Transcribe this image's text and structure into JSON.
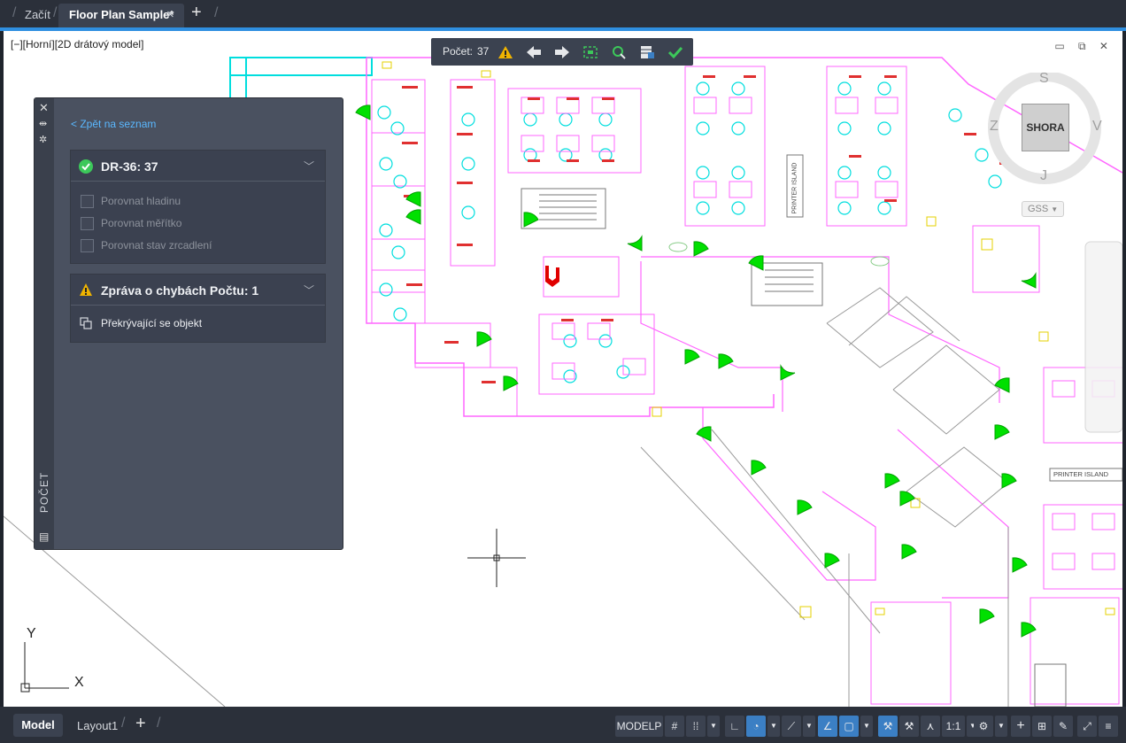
{
  "tabs": {
    "start": "Začít",
    "document": "Floor Plan Sample*",
    "close_glyph": "×",
    "new_glyph": "+"
  },
  "viewport": {
    "view_label": "[−][Horní][2D drátový model]",
    "window_controls": "▭ ⧉ ✕"
  },
  "viewcube": {
    "top": "SHORA",
    "north": "S",
    "south": "J",
    "east": "V",
    "west": "Z",
    "ucs": "GSS"
  },
  "plan_labels": {
    "printer_island_vertical": "PRINTER ISLAND",
    "printer_island_horizontal": "PRINTER ISLAND"
  },
  "ucs_icon": {
    "x": "X",
    "y": "Y"
  },
  "count_toolbar": {
    "label": "Počet:",
    "value": "37",
    "icons": [
      "warning-icon",
      "arrow-left-icon",
      "arrow-right-icon",
      "zoom-extents-icon",
      "find-icon",
      "table-icon",
      "check-icon"
    ]
  },
  "palette": {
    "strip_title": "POČET",
    "back_link": "< Zpět na seznam",
    "card1": {
      "title": "DR-36: 37",
      "options": [
        "Porovnat hladinu",
        "Porovnat měřítko",
        "Porovnat stav zrcadlení"
      ]
    },
    "card2": {
      "title": "Zpráva o chybách Počtu: 1",
      "item": "Překrývající se objekt"
    }
  },
  "statusbar": {
    "model_tab": "Model",
    "layout_tab": "Layout1",
    "add_glyph": "+",
    "modelspace": "MODELP",
    "scale": "1:1"
  },
  "colors": {
    "accent": "#2f8fe0",
    "door": "#00e000",
    "furniture": "#00e6e6",
    "walls": "#ff66ff",
    "error_block": "#e00000",
    "warning": "#f0b400",
    "success": "#3cc85a"
  }
}
